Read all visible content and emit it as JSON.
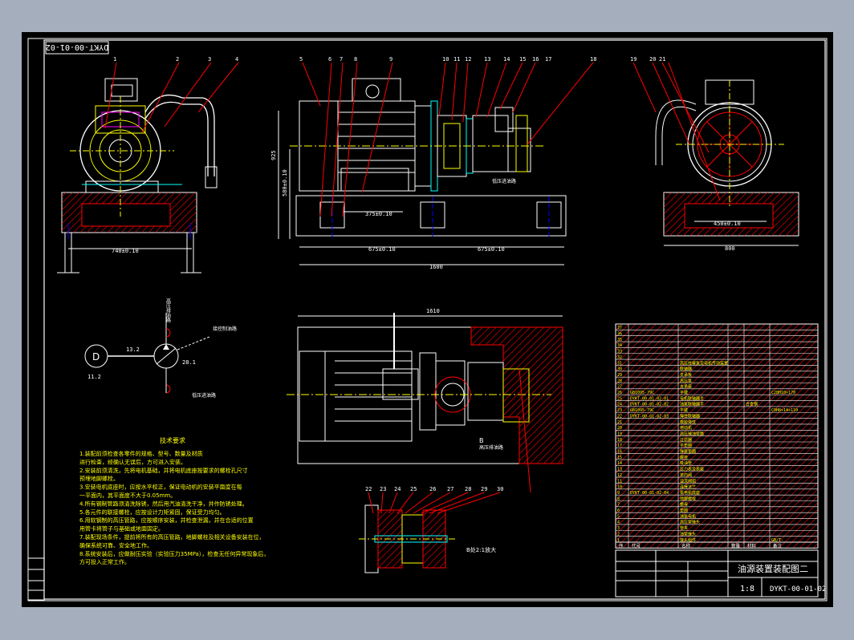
{
  "drawing": {
    "code_flipped": "DYKT-00-01-02",
    "title": "油源装置装配图二",
    "scale": "1:8",
    "code": "DYKT-00-01-02"
  },
  "views": {
    "front_dim_width": "740±0.10",
    "front_dim_height": "925",
    "side_dim_center": "580±0.10",
    "mount_dim": "375±0.10",
    "base_dim_left": "675±0.10",
    "base_dim_right": "675±0.10",
    "base_length": "1600",
    "right_dim_inner": "450±0.10",
    "right_dim_width": "800",
    "top_dim_length": "1610",
    "low_pressure_in": "低压进油路",
    "high_pressure_out": "高压排油路",
    "enlarged_label": "B处2:1放大",
    "detail_b": "B"
  },
  "balloons_top": [
    "1",
    "2",
    "3",
    "4",
    "5",
    "6",
    "7",
    "8",
    "9",
    "10",
    "11",
    "12",
    "13",
    "14",
    "15",
    "16",
    "17",
    "18",
    "19",
    "20",
    "21"
  ],
  "balloons_detail": [
    "22",
    "23",
    "24",
    "25",
    "26",
    "27",
    "28",
    "29",
    "30"
  ],
  "hydraulic": {
    "motor": "D",
    "motor_num": "11.2",
    "link_num": "13.2",
    "pump_num": "28.1",
    "high_label": "高压排油路",
    "low_label": "低压进油路",
    "ctrl_label": "接控制油路"
  },
  "notes": {
    "title": "技术要求",
    "lines": [
      "1.装配前须检查各零件的规格、型号、数量及材质",
      "  进行检查，经确认无误后，方可进入安装。",
      "2.安装前须清洗，先将电机基础，并将电机底座按要求的螺栓孔尺寸",
      "  预埋地脚螺栓。",
      "3.安装电机底座时，应按水平校正，保证电动机的安装平面度在每",
      "  一平面内，其平面度不大于0.05mm。",
      "4.所有钢制管路须清洗除锈，然后用汽油清洗干净，并作防锈处理。",
      "5.各元件的联接螺栓，应按设计力矩紧固，保证受力均匀。",
      "6.用软钢制的高压管路，应按顺序安装，并检查泄漏，并在合适的位置",
      "  用管卡将管子与基础或地面固定。",
      "7.装配现场条件，提前将所有的高压管路，地脚螺栓及相关设备安装在位，",
      "  确保系统可靠、安全地工作。",
      "8.系统安装后，应做耐压实验（实验压力35MPa），检查无任何异常现象后，",
      "  方可投入正常工作。"
    ]
  },
  "bom": {
    "rows": [
      {
        "no": "37",
        "code": "",
        "name": "",
        "qty": "",
        "mat": "",
        "remark": ""
      },
      {
        "no": "36",
        "code": "",
        "name": "",
        "qty": "",
        "mat": "",
        "remark": ""
      },
      {
        "no": "35",
        "code": "",
        "name": "",
        "qty": "",
        "mat": "",
        "remark": ""
      },
      {
        "no": "34",
        "code": "",
        "name": "",
        "qty": "",
        "mat": "",
        "remark": ""
      },
      {
        "no": "33",
        "code": "",
        "name": "",
        "qty": "",
        "mat": "",
        "remark": ""
      },
      {
        "no": "32",
        "code": "",
        "name": "",
        "qty": "",
        "mat": "",
        "remark": ""
      },
      {
        "no": "31",
        "code": "",
        "name": "高压柱塞泵及电机传动装置",
        "qty": "",
        "mat": "",
        "remark": ""
      },
      {
        "no": "30",
        "code": "",
        "name": "联轴器",
        "qty": "",
        "mat": "",
        "remark": ""
      },
      {
        "no": "29",
        "code": "",
        "name": "支承板",
        "qty": "",
        "mat": "",
        "remark": ""
      },
      {
        "no": "28",
        "code": "",
        "name": "高压泵",
        "qty": "",
        "mat": "",
        "remark": ""
      },
      {
        "no": "27",
        "code": "",
        "name": "支承座",
        "qty": "",
        "mat": "",
        "remark": ""
      },
      {
        "no": "26",
        "code": "GB1095-79C",
        "name": "平键",
        "qty": "",
        "mat": "",
        "remark": "C28H10×170"
      },
      {
        "no": "25",
        "code": "DYKT-00-01-02-01",
        "name": "电机联轴器半",
        "qty": "",
        "mat": "",
        "remark": ""
      },
      {
        "no": "24",
        "code": "DYKT-00-01-02-02",
        "name": "油泵联轴器半",
        "qty": "",
        "mat": "合金钢",
        "remark": ""
      },
      {
        "no": "23",
        "code": "GB1095-79C",
        "name": "平键",
        "qty": "",
        "mat": "",
        "remark": "C8H8×14×110"
      },
      {
        "no": "22",
        "code": "DYKT-00-01-02-03",
        "name": "弹性联轴器",
        "qty": "",
        "mat": "",
        "remark": ""
      },
      {
        "no": "21",
        "code": "",
        "name": "橡胶弹性",
        "qty": "",
        "mat": "",
        "remark": ""
      },
      {
        "no": "20",
        "code": "",
        "name": "电动机",
        "qty": "",
        "mat": "",
        "remark": ""
      },
      {
        "no": "19",
        "code": "",
        "name": "高压输油管路",
        "qty": "",
        "mat": "",
        "remark": ""
      },
      {
        "no": "18",
        "code": "",
        "name": "过滤器",
        "qty": "",
        "mat": "",
        "remark": ""
      },
      {
        "no": "17",
        "code": "",
        "name": "平垫圈",
        "qty": "",
        "mat": "",
        "remark": ""
      },
      {
        "no": "16",
        "code": "",
        "name": "弹簧垫圈",
        "qty": "",
        "mat": "",
        "remark": ""
      },
      {
        "no": "15",
        "code": "",
        "name": "螺栓",
        "qty": "",
        "mat": "",
        "remark": ""
      },
      {
        "no": "14",
        "code": "",
        "name": "吸油管",
        "qty": "",
        "mat": "",
        "remark": ""
      },
      {
        "no": "13",
        "code": "",
        "name": "压力表及表座",
        "qty": "",
        "mat": "",
        "remark": ""
      },
      {
        "no": "12",
        "code": "",
        "name": "单向阀",
        "qty": "",
        "mat": "",
        "remark": ""
      },
      {
        "no": "11",
        "code": "",
        "name": "溢流阀组",
        "qty": "",
        "mat": "",
        "remark": ""
      },
      {
        "no": "10",
        "code": "",
        "name": "连接法兰",
        "qty": "",
        "mat": "",
        "remark": ""
      },
      {
        "no": "9",
        "code": "DYKT-00-01-02-04",
        "name": "泵电机底座",
        "qty": "",
        "mat": "",
        "remark": ""
      },
      {
        "no": "8",
        "code": "",
        "name": "地脚螺栓",
        "qty": "",
        "mat": "",
        "remark": ""
      },
      {
        "no": "7",
        "code": "",
        "name": "螺母",
        "qty": "",
        "mat": "",
        "remark": ""
      },
      {
        "no": "6",
        "code": "",
        "name": "垫圈",
        "qty": "",
        "mat": "",
        "remark": ""
      },
      {
        "no": "5",
        "code": "",
        "name": "油泵电机",
        "qty": "",
        "mat": "",
        "remark": ""
      },
      {
        "no": "4",
        "code": "",
        "name": "高压管接头",
        "qty": "",
        "mat": "",
        "remark": ""
      },
      {
        "no": "3",
        "code": "",
        "name": "管夹",
        "qty": "",
        "mat": "",
        "remark": ""
      },
      {
        "no": "2",
        "code": "",
        "name": "油管接头",
        "qty": "",
        "mat": "",
        "remark": ""
      },
      {
        "no": "1",
        "code": "",
        "name": "接头组件",
        "qty": "",
        "mat": "",
        "remark": "GB/T-"
      }
    ],
    "header": {
      "no": "序",
      "code": "代号",
      "name": "名称",
      "qty": "数量",
      "mat": "材料",
      "remark": "备注"
    }
  },
  "colors": {
    "line_white": "#ffffff",
    "line_yellow": "#ffff00",
    "line_red": "#ff0000",
    "line_cyan": "#00ffff",
    "line_blue": "#0000ff",
    "line_green": "#00ff00",
    "line_magenta": "#ff00ff"
  }
}
